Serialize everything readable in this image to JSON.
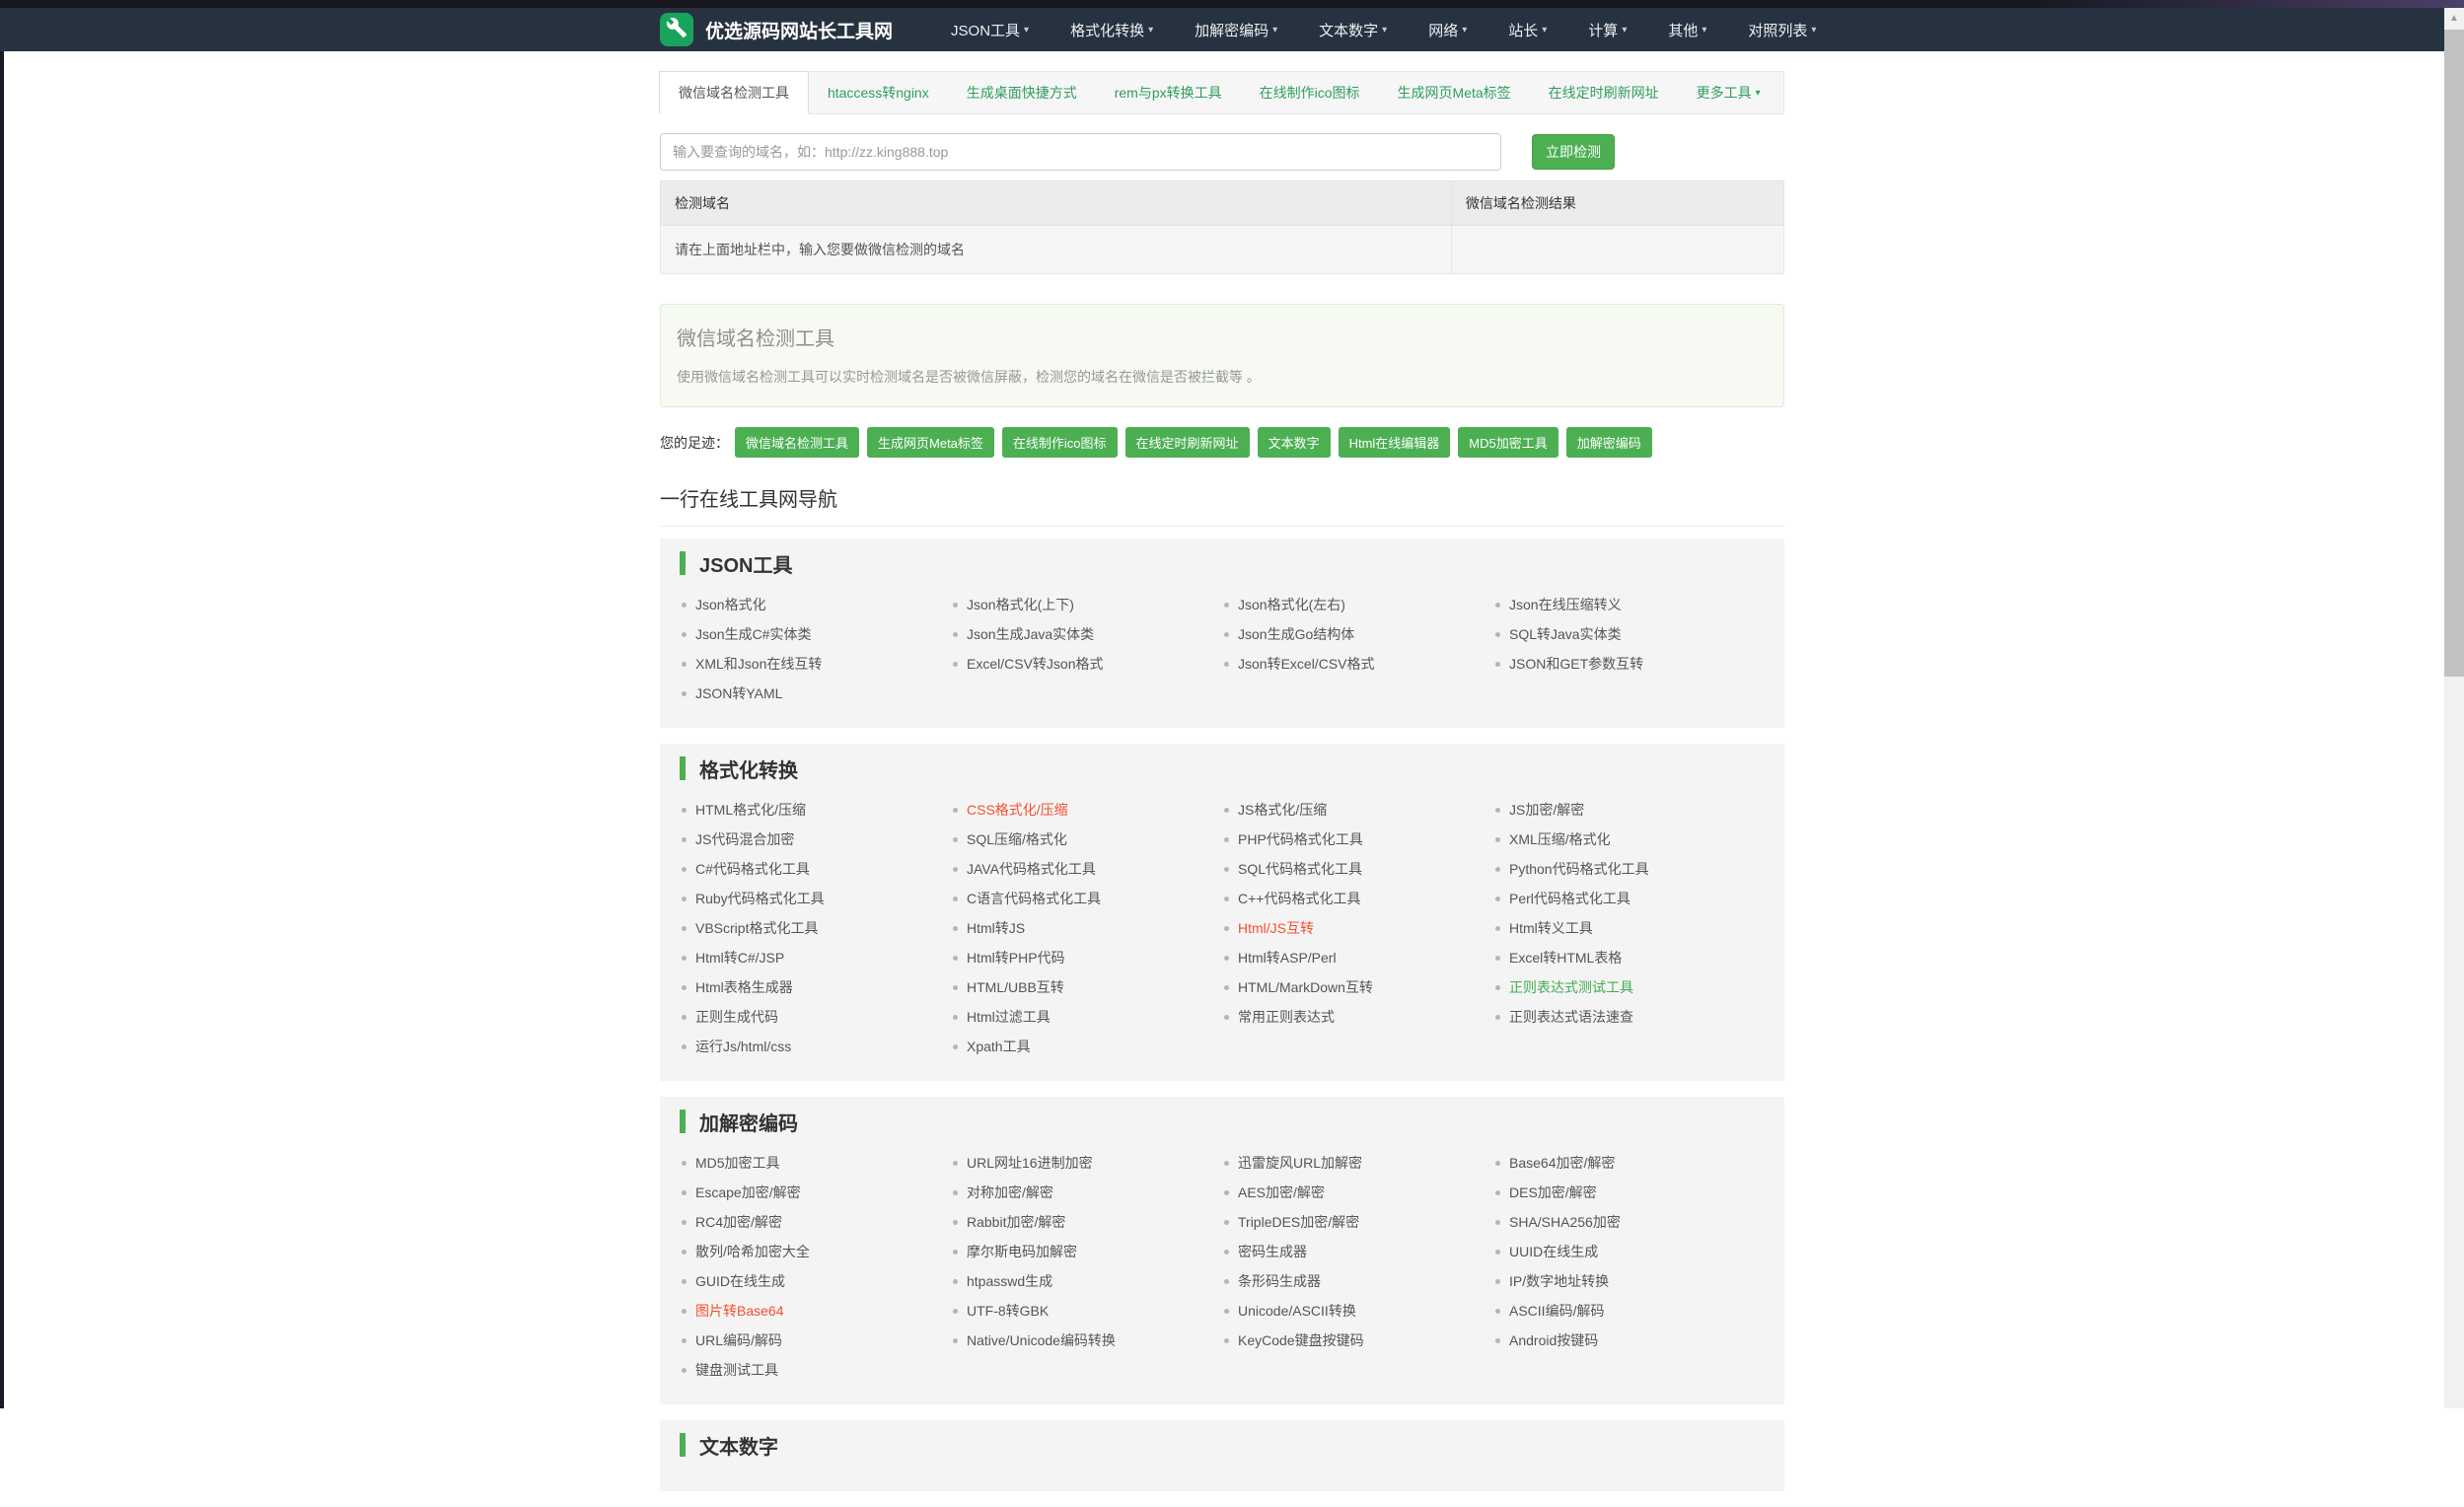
{
  "navbar": {
    "brand": "优选源码网站长工具网",
    "logo_icon": "wrench-icon",
    "menus": [
      {
        "label": "JSON工具"
      },
      {
        "label": "格式化转换"
      },
      {
        "label": "加解密编码"
      },
      {
        "label": "文本数字"
      },
      {
        "label": "网络"
      },
      {
        "label": "站长"
      },
      {
        "label": "计算"
      },
      {
        "label": "其他"
      },
      {
        "label": "对照列表"
      }
    ]
  },
  "tabs": [
    {
      "label": "微信域名检测工具",
      "active": true
    },
    {
      "label": "htaccess转nginx"
    },
    {
      "label": "生成桌面快捷方式"
    },
    {
      "label": "rem与px转换工具"
    },
    {
      "label": "在线制作ico图标"
    },
    {
      "label": "生成网页Meta标签"
    },
    {
      "label": "在线定时刷新网址"
    },
    {
      "label": "更多工具",
      "caret": true
    }
  ],
  "search": {
    "placeholder": "输入要查询的域名，如：http://zz.king888.top",
    "button": "立即检测"
  },
  "result_table": {
    "headers": [
      "检测域名",
      "微信域名检测结果"
    ],
    "rows": [
      [
        "请在上面地址栏中，输入您要做微信检测的域名",
        ""
      ]
    ]
  },
  "info_box": {
    "title": "微信域名检测工具",
    "desc": "使用微信域名检测工具可以实时检测域名是否被微信屏蔽，检测您的域名在微信是否被拦截等 。"
  },
  "footprints": {
    "label": "您的足迹：",
    "badges": [
      "微信域名检测工具",
      "生成网页Meta标签",
      "在线制作ico图标",
      "在线定时刷新网址",
      "文本数字",
      "Html在线编辑器",
      "MD5加密工具",
      "加解密编码"
    ]
  },
  "nav_heading": "一行在线工具网导航",
  "sections": [
    {
      "title": "JSON工具",
      "items": [
        {
          "label": "Json格式化"
        },
        {
          "label": "Json格式化(上下)"
        },
        {
          "label": "Json格式化(左右)"
        },
        {
          "label": "Json在线压缩转义"
        },
        {
          "label": "Json生成C#实体类"
        },
        {
          "label": "Json生成Java实体类"
        },
        {
          "label": "Json生成Go结构体"
        },
        {
          "label": "SQL转Java实体类"
        },
        {
          "label": "XML和Json在线互转"
        },
        {
          "label": "Excel/CSV转Json格式"
        },
        {
          "label": "Json转Excel/CSV格式"
        },
        {
          "label": "JSON和GET参数互转"
        },
        {
          "label": "JSON转YAML"
        }
      ]
    },
    {
      "title": "格式化转换",
      "items": [
        {
          "label": "HTML格式化/压缩"
        },
        {
          "label": "CSS格式化/压缩",
          "color": "red"
        },
        {
          "label": "JS格式化/压缩"
        },
        {
          "label": "JS加密/解密"
        },
        {
          "label": "JS代码混合加密"
        },
        {
          "label": "SQL压缩/格式化"
        },
        {
          "label": "PHP代码格式化工具"
        },
        {
          "label": "XML压缩/格式化"
        },
        {
          "label": "C#代码格式化工具"
        },
        {
          "label": "JAVA代码格式化工具"
        },
        {
          "label": "SQL代码格式化工具"
        },
        {
          "label": "Python代码格式化工具"
        },
        {
          "label": "Ruby代码格式化工具"
        },
        {
          "label": "C语言代码格式化工具"
        },
        {
          "label": "C++代码格式化工具"
        },
        {
          "label": "Perl代码格式化工具"
        },
        {
          "label": "VBScript格式化工具"
        },
        {
          "label": "Html转JS"
        },
        {
          "label": "Html/JS互转",
          "color": "red"
        },
        {
          "label": "Html转义工具"
        },
        {
          "label": "Html转C#/JSP"
        },
        {
          "label": "Html转PHP代码"
        },
        {
          "label": "Html转ASP/Perl"
        },
        {
          "label": "Excel转HTML表格"
        },
        {
          "label": "Html表格生成器"
        },
        {
          "label": "HTML/UBB互转"
        },
        {
          "label": "HTML/MarkDown互转"
        },
        {
          "label": "正则表达式测试工具",
          "color": "green"
        },
        {
          "label": "正则生成代码"
        },
        {
          "label": "Html过滤工具"
        },
        {
          "label": "常用正则表达式"
        },
        {
          "label": "正则表达式语法速查"
        },
        {
          "label": "运行Js/html/css"
        },
        {
          "label": "Xpath工具"
        }
      ]
    },
    {
      "title": "加解密编码",
      "items": [
        {
          "label": "MD5加密工具"
        },
        {
          "label": "URL网址16进制加密"
        },
        {
          "label": "迅雷旋风URL加解密"
        },
        {
          "label": "Base64加密/解密"
        },
        {
          "label": "Escape加密/解密"
        },
        {
          "label": "对称加密/解密"
        },
        {
          "label": "AES加密/解密"
        },
        {
          "label": "DES加密/解密"
        },
        {
          "label": "RC4加密/解密"
        },
        {
          "label": "Rabbit加密/解密"
        },
        {
          "label": "TripleDES加密/解密"
        },
        {
          "label": "SHA/SHA256加密"
        },
        {
          "label": "散列/哈希加密大全"
        },
        {
          "label": "摩尔斯电码加解密"
        },
        {
          "label": "密码生成器"
        },
        {
          "label": "UUID在线生成"
        },
        {
          "label": "GUID在线生成"
        },
        {
          "label": "htpasswd生成"
        },
        {
          "label": "条形码生成器"
        },
        {
          "label": "IP/数字地址转换"
        },
        {
          "label": "图片转Base64",
          "color": "red"
        },
        {
          "label": "UTF-8转GBK"
        },
        {
          "label": "Unicode/ASCII转换"
        },
        {
          "label": "ASCII编码/解码"
        },
        {
          "label": "URL编码/解码"
        },
        {
          "label": "Native/Unicode编码转换"
        },
        {
          "label": "KeyCode键盘按键码"
        },
        {
          "label": "Android按键码"
        },
        {
          "label": "键盘测试工具"
        }
      ]
    },
    {
      "title": "文本数字",
      "clipped": true,
      "items": []
    }
  ],
  "colors": {
    "navbar_bg": "#263240",
    "brand_logo_green": "#1aa35d",
    "accent_green": "#4cb052",
    "tab_link_green": "#2e9e5c",
    "hot_link_red": "#f4502e",
    "card_bg": "#f4f4f4",
    "info_box_bg": "#f6faf3"
  },
  "scrollbar": {
    "up_arrow": "▲"
  }
}
